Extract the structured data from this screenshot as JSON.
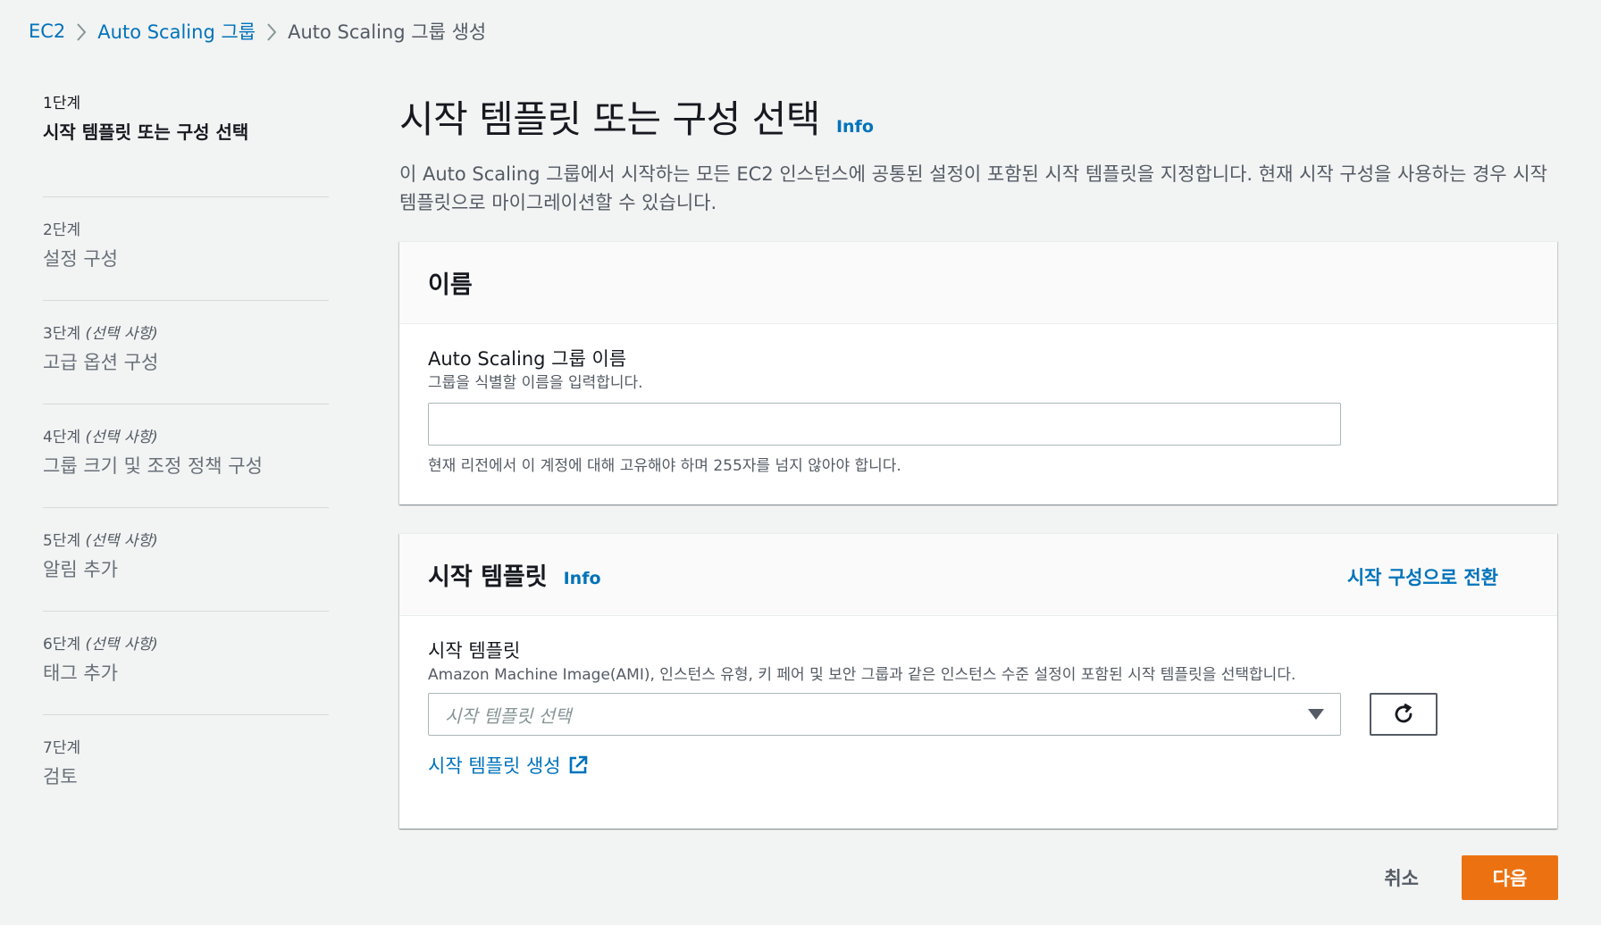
{
  "breadcrumb": {
    "items": [
      "EC2",
      "Auto Scaling 그룹"
    ],
    "current": "Auto Scaling 그룹 생성"
  },
  "steps": [
    {
      "num": "1단계",
      "optional": "",
      "title": "시작 템플릿 또는 구성 선택"
    },
    {
      "num": "2단계",
      "optional": "",
      "title": "설정 구성"
    },
    {
      "num": "3단계",
      "optional": "(선택 사항)",
      "title": "고급 옵션 구성"
    },
    {
      "num": "4단계",
      "optional": "(선택 사항)",
      "title": "그룹 크기 및 조정 정책 구성"
    },
    {
      "num": "5단계",
      "optional": "(선택 사항)",
      "title": "알림 추가"
    },
    {
      "num": "6단계",
      "optional": "(선택 사항)",
      "title": "태그 추가"
    },
    {
      "num": "7단계",
      "optional": "",
      "title": "검토"
    }
  ],
  "page": {
    "title": "시작 템플릿 또는 구성 선택",
    "info": "Info",
    "description": "이 Auto Scaling 그룹에서 시작하는 모든 EC2 인스턴스에 공통된 설정이 포함된 시작 템플릿을 지정합니다. 현재 시작 구성을 사용하는 경우 시작 템플릿으로 마이그레이션할 수 있습니다."
  },
  "name_panel": {
    "header": "이름",
    "label": "Auto Scaling 그룹 이름",
    "description": "그룹을 식별할 이름을 입력합니다.",
    "value": "",
    "constraint": "현재 리전에서 이 계정에 대해 고유해야 하며 255자를 넘지 않아야 합니다."
  },
  "template_panel": {
    "header": "시작 템플릿",
    "info": "Info",
    "switch_link": "시작 구성으로 전환",
    "label": "시작 템플릿",
    "description": "Amazon Machine Image(AMI), 인스턴스 유형, 키 페어 및 보안 그룹과 같은 인스턴스 수준 설정이 포함된 시작 템플릿을 선택합니다.",
    "select_placeholder": "시작 템플릿 선택",
    "create_link": "시작 템플릿 생성"
  },
  "actions": {
    "cancel": "취소",
    "next": "다음"
  },
  "colors": {
    "link": "#0073bb",
    "primary": "#ec7211",
    "background": "#f2f3f3"
  }
}
